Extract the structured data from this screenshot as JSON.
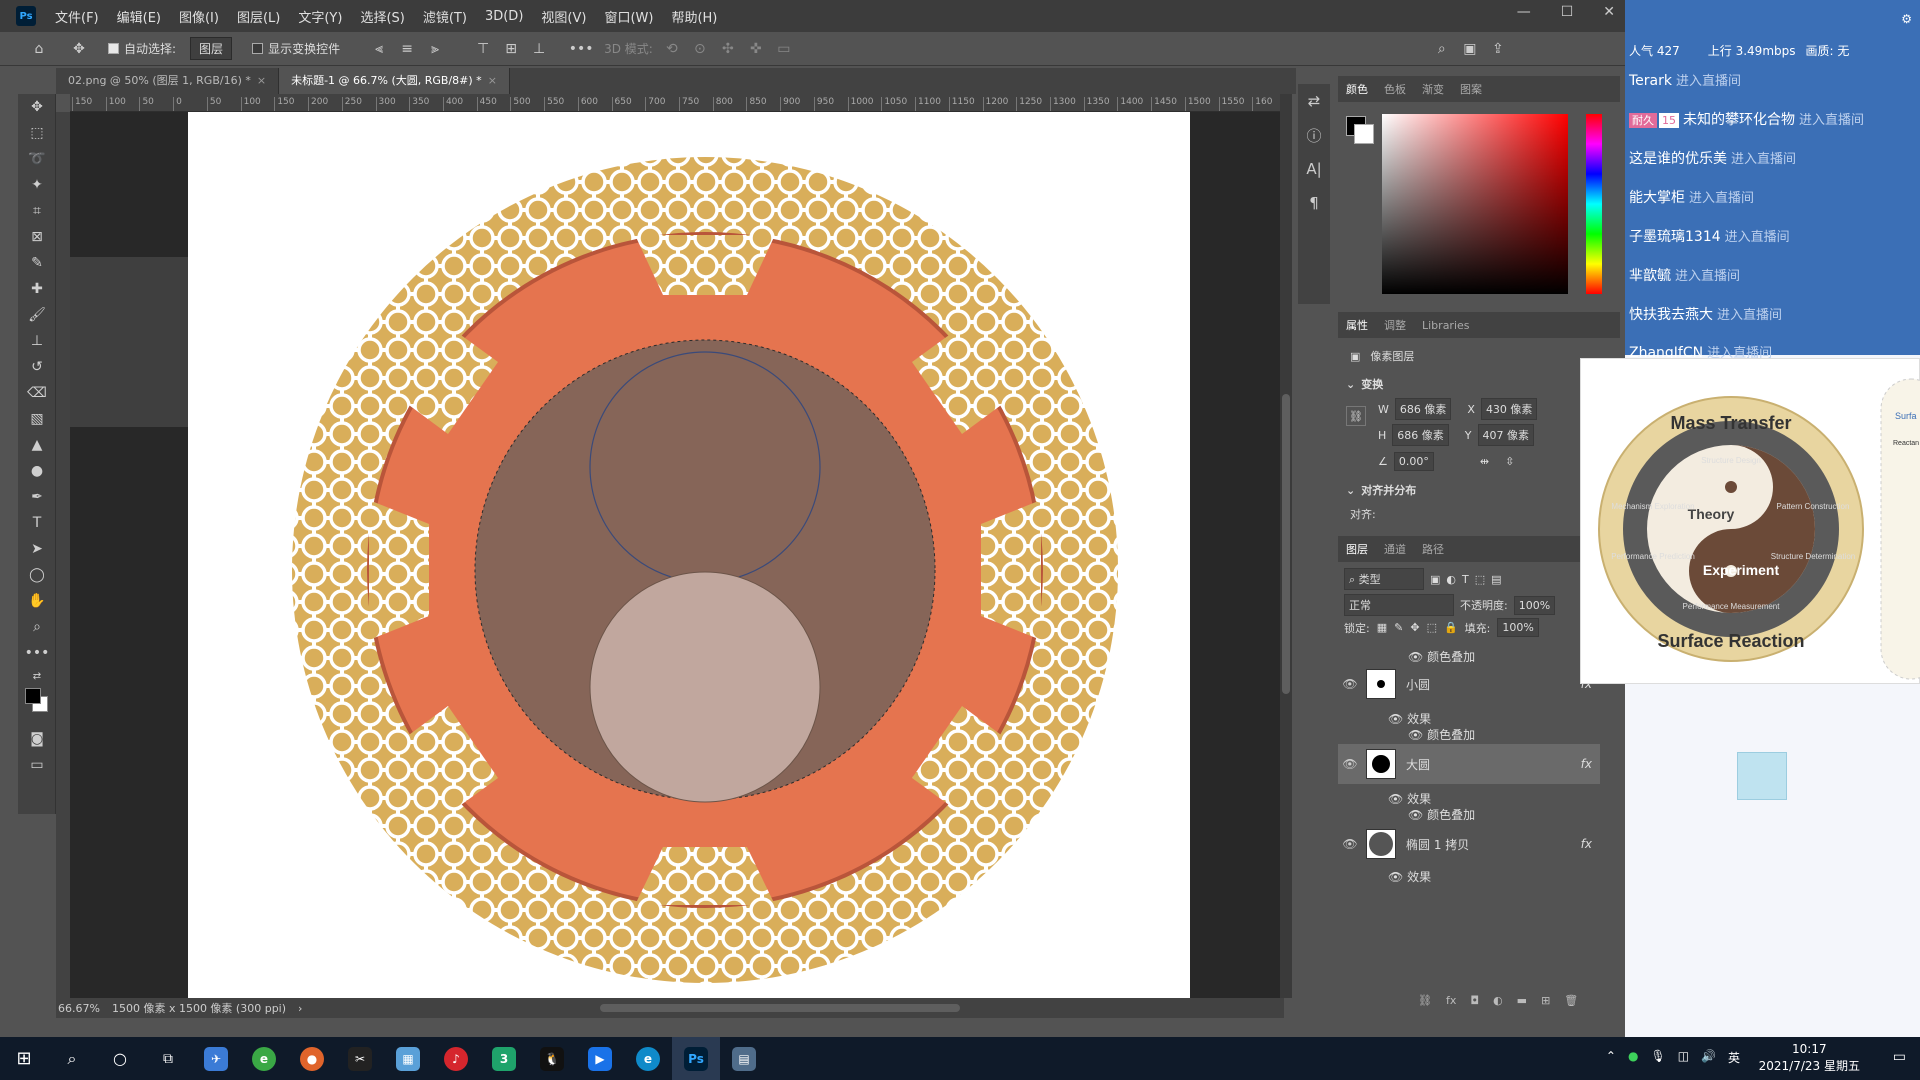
{
  "menubar": {
    "logo": "Ps",
    "items": [
      "文件(F)",
      "编辑(E)",
      "图像(I)",
      "图层(L)",
      "文字(Y)",
      "选择(S)",
      "滤镜(T)",
      "3D(D)",
      "视图(V)",
      "窗口(W)",
      "帮助(H)"
    ]
  },
  "options": {
    "auto_select_label": "自动选择:",
    "auto_select_value": "图层",
    "show_transform_label": "显示变换控件",
    "mode_3d_label": "3D 模式:"
  },
  "tabs": [
    {
      "label": "02.png @ 50% (图层 1, RGB/16) *"
    },
    {
      "label": "未标题-1 @ 66.7% (大圆, RGB/8#) *"
    }
  ],
  "ruler": {
    "ticks": [
      "150",
      "100",
      "50",
      "0",
      "50",
      "100",
      "150",
      "200",
      "250",
      "300",
      "350",
      "400",
      "450",
      "500",
      "550",
      "600",
      "650",
      "700",
      "750",
      "800",
      "850",
      "900",
      "950",
      "1000",
      "1050",
      "1100",
      "1150",
      "1200",
      "1250",
      "1300",
      "1350",
      "1400",
      "1450",
      "1500",
      "1550",
      "160"
    ]
  },
  "status": {
    "zoom": "66.67%",
    "doc_size": "1500 像素 x 1500 像素 (300 ppi)"
  },
  "color_panel": {
    "tabs": [
      "颜色",
      "色板",
      "渐变",
      "图案"
    ]
  },
  "properties": {
    "tabs": [
      "属性",
      "调整",
      "Libraries"
    ],
    "type_label": "像素图层",
    "transform_title": "变换",
    "w_label": "W",
    "w_value": "686 像素",
    "x_label": "X",
    "x_value": "430 像素",
    "h_label": "H",
    "h_value": "686 像素",
    "y_label": "Y",
    "y_value": "407 像素",
    "angle_value": "0.00°",
    "align_title": "对齐并分布",
    "align_label": "对齐:"
  },
  "layers_panel": {
    "tabs": [
      "图层",
      "通道",
      "路径"
    ],
    "filter_value": "类型",
    "blend_mode": "正常",
    "opacity_label": "不透明度:",
    "opacity_value": "100%",
    "lock_label": "锁定:",
    "fill_label": "填充:",
    "fill_value": "100%",
    "layers": [
      {
        "name": "颜色叠加",
        "kind": "effect-item"
      },
      {
        "name": "小圆",
        "kind": "layer",
        "fx": "fx"
      },
      {
        "name": "效果",
        "kind": "effect"
      },
      {
        "name": "颜色叠加",
        "kind": "effect-item"
      },
      {
        "name": "大圆",
        "kind": "layer",
        "fx": "fx",
        "selected": true
      },
      {
        "name": "效果",
        "kind": "effect"
      },
      {
        "name": "颜色叠加",
        "kind": "effect-item"
      },
      {
        "name": "椭圆 1 拷贝",
        "kind": "layer",
        "fx": "fx"
      },
      {
        "name": "效果",
        "kind": "effect"
      }
    ]
  },
  "live": {
    "popularity_label": "人气",
    "popularity_value": "427",
    "upload_label": "上行",
    "upload_value": "3.49mbps",
    "quality_label": "画质: 无",
    "join_text": "进入直播间",
    "badge_label": "耐久",
    "badge_level": "15",
    "messages": [
      {
        "user": "Terark"
      },
      {
        "user": "未知的攀环化合物"
      },
      {
        "user": "这是谁的优乐美"
      },
      {
        "user": "能大掌柜"
      },
      {
        "user": "子墨琉璃1314"
      },
      {
        "user": "芈歆毓"
      },
      {
        "user": "快扶我去燕大"
      },
      {
        "user": "ZhangIfCN"
      }
    ]
  },
  "popup": {
    "title_top": "Mass Transfer",
    "title_bottom": "Surface Reaction",
    "theory": "Theory",
    "experiment": "Experiment",
    "labels": [
      "Structure Design",
      "Pattern Construction",
      "Structure Determination",
      "Performance Measurement",
      "Performance Prediction",
      "Mechanism Exploration"
    ],
    "side_text_1": "Surfa",
    "side_text_2": "Reactan"
  },
  "taskbar": {
    "time": "10:17",
    "date": "2021/7/23 星期五",
    "ime": "英"
  },
  "colors": {
    "pattern": "#d9ae5a",
    "ring": "#e5744f",
    "inner": "#866558",
    "small_circle": "#c1a79e"
  }
}
